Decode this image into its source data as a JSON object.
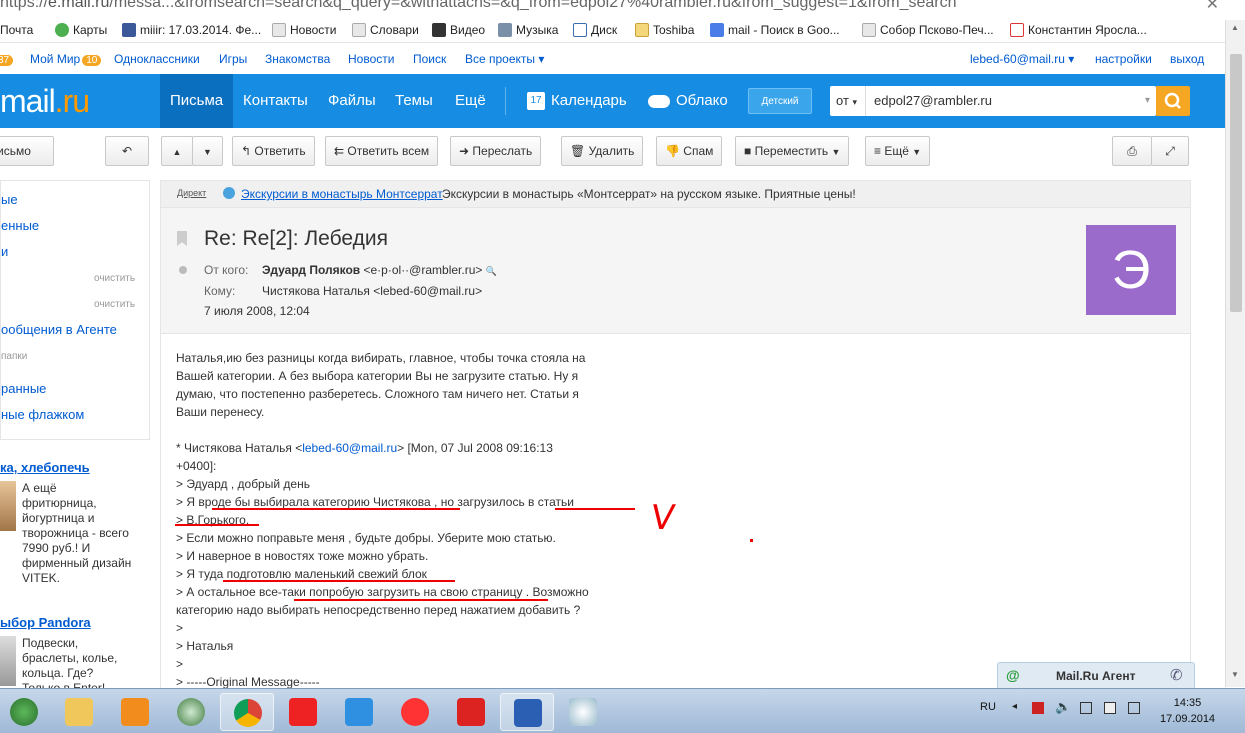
{
  "browser": {
    "url_prefix": "https://",
    "url_domain": "e.mail.ru",
    "url_rest": "/messa...&fromsearch=search&q_query=&withattachs=&q_from=edpol27%40rambler.ru&from_suggest=1&from_search",
    "close_glyph": "✕",
    "bookmarks": [
      "Почта",
      "Карты",
      "miiir: 17.03.2014. Фе...",
      "Новости",
      "Словари",
      "Видео",
      "Музыка",
      "Диск",
      "Toshiba",
      "mail - Поиск в Goo...",
      "Собор Псково-Печ...",
      "Константин Яросла..."
    ]
  },
  "topnav": {
    "first_badge": "37",
    "moimir": "Мой Мир",
    "moimir_badge": "10",
    "odnoklassniki": "Одноклассники",
    "igry": "Игры",
    "znakomstva": "Знакомства",
    "novosti": "Новости",
    "poisk": "Поиск",
    "vse_proekty": "Все проекты ▾",
    "user": "lebed-60@mail.ru ▾",
    "settings": "настройки",
    "exit": "выход"
  },
  "header": {
    "logo_main": "mail",
    "logo_ru": ".ru",
    "nav": [
      "Письма",
      "Контакты",
      "Файлы",
      "Темы",
      "Ещё"
    ],
    "calendar_day": "17",
    "calendar": "Календарь",
    "cloud": "Облако",
    "detsky": "Детский",
    "search_select": "от",
    "search_value": "edpol27@rambler.ru"
  },
  "toolbar": {
    "write": "исьмо",
    "answer": "Ответить",
    "answer_all": "Ответить всем",
    "forward": "Переслать",
    "delete": "Удалить",
    "spam": "Спам",
    "move": "Переместить",
    "more": "Ещё"
  },
  "sidebar": {
    "items": [
      "ые",
      "енные",
      "и",
      "очистить",
      "очистить",
      "ообщения в Агенте",
      "папки",
      "ранные",
      "ные флажком"
    ]
  },
  "ads": {
    "a1_title": "ка, хлебопечь",
    "a1_lines": [
      "А ещё",
      "фритюрница,",
      "йогуртница и",
      "творожница - всего",
      "7990 руб.! И",
      "фирменный дизайн",
      "VITEK."
    ],
    "a2_title": "ыбор Pandora",
    "a2_lines": [
      "Подвески,",
      "браслеты, колье,",
      "кольца. Где?",
      "Только в Enter!"
    ]
  },
  "direct": {
    "label": "Директ",
    "link": "Экскурсии в монастырь Монтсеррат",
    "text": "Экскурсии в монастырь «Монтсеррат» на русском языке. Приятные цены!"
  },
  "message": {
    "subject": "Re: Re[2]: Лебедия",
    "from_label": "От кого:",
    "from_name": "Эдуард Поляков",
    "from_email": "<e·p·ol··@rambler.ru>",
    "to_label": "Кому:",
    "to_value": "Чистякова Наталья <lebed-60@mail.ru>",
    "date": "7 июля 2008, 12:04",
    "avatar_letter": "Э",
    "body_lines": [
      "Наталья,ию без разницы когда вибирать, главное, чтобы точка стояла на",
      "Вашей категории. А без выбора категории Вы не загрузите статью. Ну я",
      "думаю, что постепенно разберетесь. Сложного там ничего нет. Статьи я",
      "Ваши перенесу."
    ],
    "quote_head_a": "* Чистякова Наталья <",
    "quote_head_link": "lebed-60@mail.ru",
    "quote_head_b": "> [Mon, 07 Jul 2008 09:16:13",
    "quote_lines": [
      "+0400]:",
      "> Эдуард , добрый день",
      "> Я вроде бы выбирала категорию Чистякова , но загрузилось в статьи",
      "> В.Горького.",
      "> Если можно поправьте меня , будьте добры. Уберите мою статью.",
      "> И наверное в новостях тоже можно убрать.",
      "> Я туда подготовлю маленький свежий блок",
      "> А остальное все-таки попробую загрузить на свою страницу . Возможно",
      "  категорию надо выбирать непосредственно перед нажатием добавить ?",
      ">",
      "> Наталья",
      ">",
      "> -----Original Message-----"
    ],
    "handwritten_mark": "V"
  },
  "agent": {
    "title": "Mail.Ru Агент"
  },
  "taskbar": {
    "lang": "RU",
    "time": "14:35",
    "date": "17.09.2014"
  },
  "colors": {
    "header": "#168de2",
    "accent": "#f5a623",
    "annotation": "#e00000"
  }
}
